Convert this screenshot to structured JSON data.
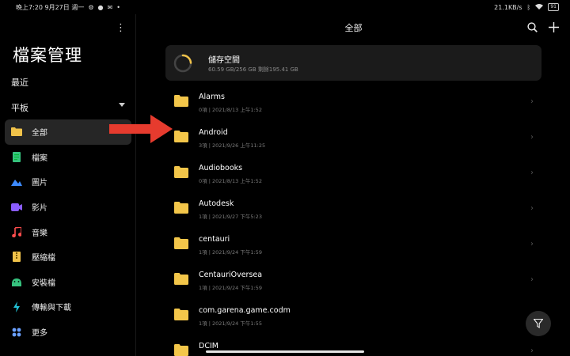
{
  "status_bar": {
    "left_text": "晚上7:20 9月27日 週一",
    "speed": "21.1KB/s",
    "battery": "91"
  },
  "sidebar": {
    "title": "檔案管理",
    "recent_label": "最近",
    "tablet_label": "平板",
    "items": [
      {
        "label": "全部",
        "icon": "folder-icon",
        "color": "#f0c24a"
      },
      {
        "label": "檔案",
        "icon": "document-icon",
        "color": "#36c27e"
      },
      {
        "label": "圖片",
        "icon": "image-icon",
        "color": "#3d8bff"
      },
      {
        "label": "影片",
        "icon": "video-icon",
        "color": "#8a5cff"
      },
      {
        "label": "音樂",
        "icon": "music-icon",
        "color": "#ff4d4d"
      },
      {
        "label": "壓縮檔",
        "icon": "archive-icon",
        "color": "#f0c24a"
      },
      {
        "label": "安裝檔",
        "icon": "android-icon",
        "color": "#36c27e"
      },
      {
        "label": "傳輸與下載",
        "icon": "transfer-icon",
        "color": "#22c1d6"
      },
      {
        "label": "更多",
        "icon": "more-grid-icon",
        "color": "#6aa0ff"
      }
    ]
  },
  "main": {
    "title": "全部",
    "storage": {
      "title": "儲存空間",
      "subtitle": "60.59 GB/256 GB  剩餘195.41 GB",
      "used_fraction": 0.24
    },
    "folders": [
      {
        "name": "Alarms",
        "meta": "0項 | 2021/8/13 上午1:52"
      },
      {
        "name": "Android",
        "meta": "3項 | 2021/9/26 上午11:25"
      },
      {
        "name": "Audiobooks",
        "meta": "0項 | 2021/8/13 上午1:52"
      },
      {
        "name": "Autodesk",
        "meta": "1項 | 2021/9/27 下午5:23"
      },
      {
        "name": "centauri",
        "meta": "1項 | 2021/9/24 下午1:59"
      },
      {
        "name": "CentauriOversea",
        "meta": "1項 | 2021/9/24 下午1:59"
      },
      {
        "name": "com.garena.game.codm",
        "meta": "1項 | 2021/9/24 下午1:55"
      },
      {
        "name": "DCIM",
        "meta": ""
      }
    ]
  },
  "colors": {
    "accent_arrow": "#e63b2e",
    "folder": "#f3c64a",
    "ring": "#f0c24a"
  }
}
